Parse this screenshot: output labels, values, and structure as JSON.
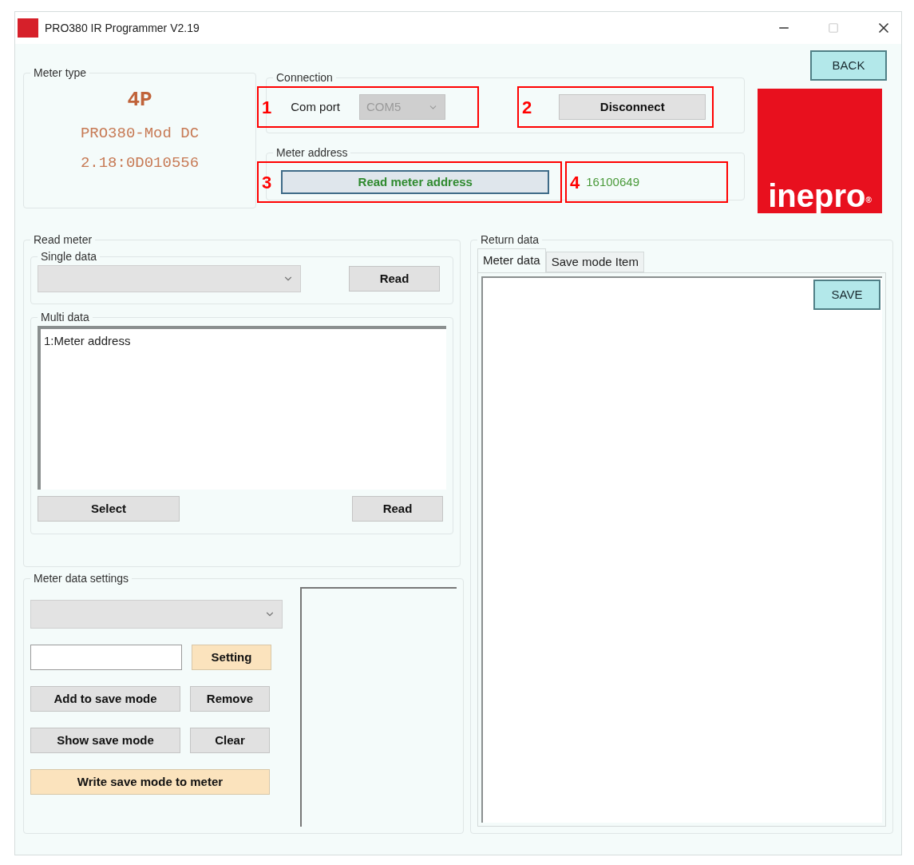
{
  "window": {
    "title": "PRO380 IR Programmer V2.19"
  },
  "back_button": {
    "label": "BACK",
    "kind": "cyan"
  },
  "meter_type": {
    "title": "Meter type",
    "phase": "4P",
    "model": "PRO380-Mod DC",
    "version": "2.18:0D010556"
  },
  "connection": {
    "title": "Connection",
    "com_port": {
      "callout": "1",
      "label": "Com port",
      "value": "COM5",
      "disabled": true
    },
    "disconnect": {
      "callout": "2",
      "label": "Disconnect",
      "kind": "plain"
    }
  },
  "meter_address": {
    "title": "Meter address",
    "button": {
      "callout": "3",
      "label": "Read meter address",
      "kind": "focused"
    },
    "value": {
      "callout": "4",
      "text": "16100649"
    }
  },
  "logo": {
    "text": "inepro",
    "mark": "®"
  },
  "read_meter": {
    "title": "Read meter",
    "single": {
      "title": "Single data",
      "read": {
        "label": "Read",
        "kind": "plain"
      }
    },
    "multi": {
      "title": "Multi data",
      "items": [
        "1:Meter address"
      ],
      "select": {
        "label": "Select",
        "kind": "plain"
      },
      "read": {
        "label": "Read",
        "kind": "plain"
      }
    }
  },
  "settings": {
    "title": "Meter data settings",
    "setting": {
      "label": "Setting",
      "kind": "accent"
    },
    "add": {
      "label": "Add to save mode",
      "kind": "plain"
    },
    "remove": {
      "label": "Remove",
      "kind": "plain"
    },
    "show": {
      "label": "Show save mode",
      "kind": "plain"
    },
    "clear": {
      "label": "Clear",
      "kind": "plain"
    },
    "write": {
      "label": "Write save mode to meter",
      "kind": "accent"
    }
  },
  "return_data": {
    "title": "Return data",
    "tabs": [
      {
        "label": "Meter data",
        "selected": true
      },
      {
        "label": "Save mode Item",
        "selected": false
      }
    ],
    "save": {
      "label": "SAVE",
      "kind": "cyan"
    }
  }
}
